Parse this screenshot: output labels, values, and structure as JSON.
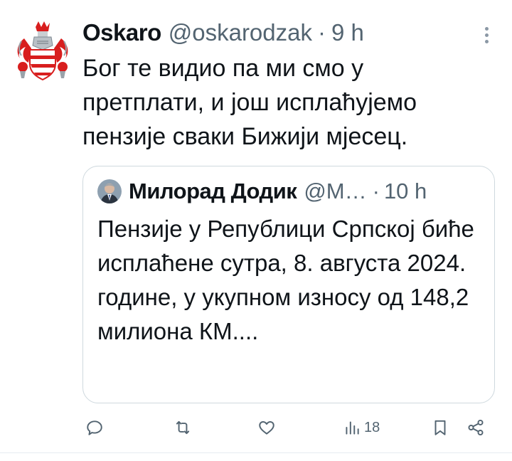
{
  "author": {
    "display_name": "Oskaro",
    "handle": "@oskarodzak",
    "separator": "·",
    "time": "9 h",
    "avatar_icon": "coat-of-arms-icon"
  },
  "tweet": {
    "text": "Бог те видио па ми смо у претплати, и још исплаћујемо пензије сваки Бижији мјесец."
  },
  "quote": {
    "display_name": "Милорад Додик",
    "handle": "@М…",
    "separator": "·",
    "time": "10 h",
    "text": "Пензије у Републици Српској биће исплаћене сутра, 8. августа 2024. године, у укупном износу од 148,2 милиона КМ...."
  },
  "actions": {
    "reply_icon": "reply-icon",
    "retweet_icon": "retweet-icon",
    "like_icon": "like-icon",
    "views_icon": "views-icon",
    "views_count": "18",
    "bookmark_icon": "bookmark-icon",
    "share_icon": "share-icon"
  },
  "colors": {
    "text": "#0f1419",
    "secondary": "#536471",
    "border": "#cfd9de",
    "coat_red": "#d81e1e"
  }
}
